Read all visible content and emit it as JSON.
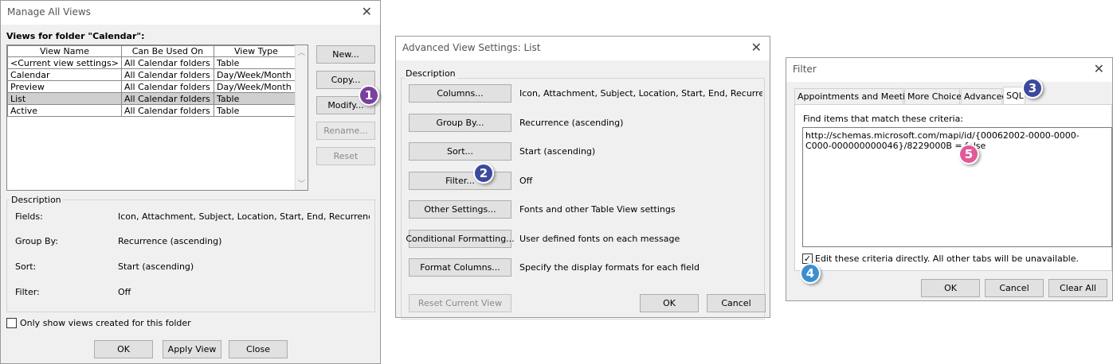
{
  "manage": {
    "title": "Manage All Views",
    "views_label": "Views for folder \"Calendar\":",
    "columns": [
      "View Name",
      "Can Be Used On",
      "View Type"
    ],
    "rows": [
      [
        "<Current view settings>",
        "All Calendar folders",
        "Table"
      ],
      [
        "Calendar",
        "All Calendar folders",
        "Day/Week/Month"
      ],
      [
        "Preview",
        "All Calendar folders",
        "Day/Week/Month"
      ],
      [
        "List",
        "All Calendar folders",
        "Table"
      ],
      [
        "Active",
        "All Calendar folders",
        "Table"
      ]
    ],
    "selected_row": 3,
    "buttons": {
      "new": "New...",
      "copy": "Copy...",
      "modify": "Modify...",
      "rename": "Rename...",
      "reset": "Reset"
    },
    "description_label": "Description",
    "desc": {
      "fields_label": "Fields:",
      "fields_value": "Icon, Attachment, Subject, Location, Start, End, Recurrence Pattern, Ca",
      "groupby_label": "Group By:",
      "groupby_value": "Recurrence (ascending)",
      "sort_label": "Sort:",
      "sort_value": "Start (ascending)",
      "filter_label": "Filter:",
      "filter_value": "Off"
    },
    "only_show_label": "Only show views created for this folder",
    "ok": "OK",
    "apply": "Apply View",
    "close": "Close"
  },
  "advanced": {
    "title": "Advanced View Settings: List",
    "description_label": "Description",
    "rows": [
      {
        "button": "Columns...",
        "value": "Icon, Attachment, Subject, Location, Start, End, Recurrence Patte..."
      },
      {
        "button": "Group By...",
        "value": "Recurrence (ascending)"
      },
      {
        "button": "Sort...",
        "value": "Start (ascending)"
      },
      {
        "button": "Filter...",
        "value": "Off"
      },
      {
        "button": "Other Settings...",
        "value": "Fonts and other Table View settings"
      },
      {
        "button": "Conditional Formatting...",
        "value": "User defined fonts on each message"
      },
      {
        "button": "Format Columns...",
        "value": "Specify the display formats for each field"
      }
    ],
    "reset": "Reset Current View",
    "ok": "OK",
    "cancel": "Cancel"
  },
  "filter": {
    "title": "Filter",
    "tabs": [
      "Appointments and Meetings",
      "More Choices",
      "Advanced",
      "SQL"
    ],
    "active_tab": "SQL",
    "find_label": "Find items that match these criteria:",
    "sql_line1": "http://schemas.microsoft.com/mapi/id/{00062002-0000-0000-",
    "sql_line2": "C000-000000000046}/8229000B = false",
    "edit_label": "Edit these criteria directly. All other tabs will be unavailable.",
    "edit_checked": true,
    "ok": "OK",
    "cancel": "Cancel",
    "clear": "Clear All"
  },
  "badges": {
    "b1": "1",
    "b2": "2",
    "b3": "3",
    "b4": "4",
    "b5": "5",
    "colors": {
      "purple": "#7b3f9e",
      "blue": "#3b4a9c",
      "sky": "#3a8fd0",
      "pink": "#e05a9a"
    }
  }
}
